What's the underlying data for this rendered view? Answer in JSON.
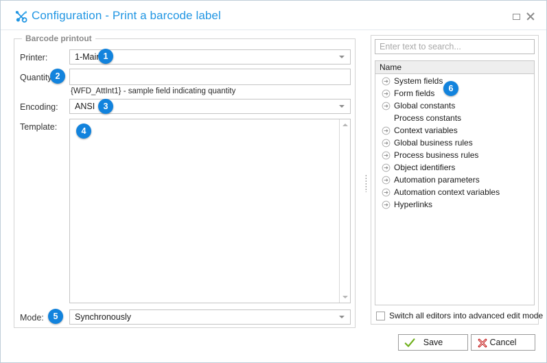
{
  "window": {
    "title": "Configuration - Print a barcode label",
    "title_icon": "tools-icon",
    "maximize_label": "Maximize",
    "close_label": "Close",
    "accent_color": "#2196e3",
    "badge_color": "#1283dd"
  },
  "left_panel": {
    "group_legend": "Barcode printout",
    "printer": {
      "label": "Printer:",
      "value": "1-Main",
      "badge": "1"
    },
    "quantity": {
      "label": "Quantity:",
      "value": "",
      "hint": "{WFD_AttInt1}  - sample field indicating quantity",
      "badge": "2"
    },
    "encoding": {
      "label": "Encoding:",
      "value": "ANSI",
      "badge": "3"
    },
    "template": {
      "label": "Template:",
      "value": "",
      "badge": "4"
    },
    "mode": {
      "label": "Mode:",
      "value": "Synchronously",
      "badge": "5"
    }
  },
  "right_panel": {
    "search": {
      "placeholder": "Enter text to search...",
      "value": ""
    },
    "tree": {
      "column_header": "Name",
      "badge": "6",
      "items": [
        {
          "label": "System fields",
          "has_icon": true
        },
        {
          "label": "Form fields",
          "has_icon": true
        },
        {
          "label": "Global constants",
          "has_icon": true
        },
        {
          "label": "Process constants",
          "has_icon": false
        },
        {
          "label": "Context variables",
          "has_icon": true
        },
        {
          "label": "Global business rules",
          "has_icon": true
        },
        {
          "label": "Process business rules",
          "has_icon": true
        },
        {
          "label": "Object identifiers",
          "has_icon": true
        },
        {
          "label": "Automation parameters",
          "has_icon": true
        },
        {
          "label": "Automation context variables",
          "has_icon": true
        },
        {
          "label": "Hyperlinks",
          "has_icon": true
        }
      ]
    },
    "advanced_mode": {
      "label": "Switch all editors into advanced edit mode",
      "checked": false
    }
  },
  "footer": {
    "save_label": "Save",
    "save_icon": "green-check-icon",
    "cancel_label": "Cancel",
    "cancel_icon": "red-cross-icon"
  }
}
